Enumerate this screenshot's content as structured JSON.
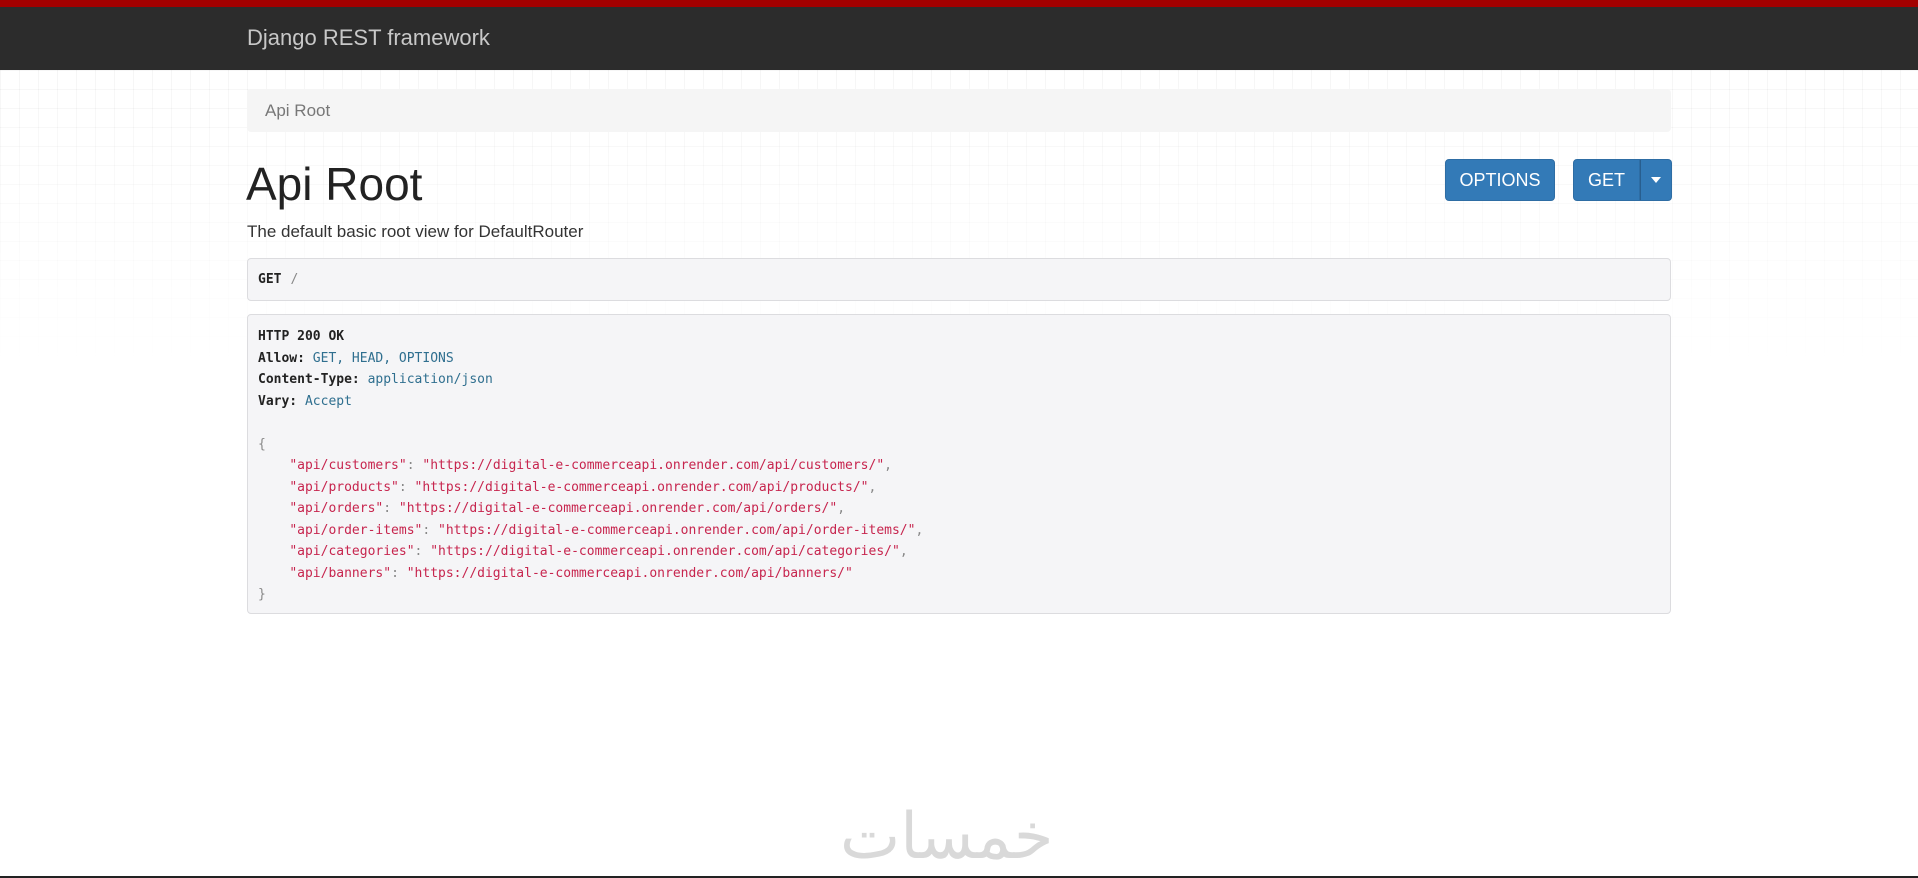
{
  "navbar": {
    "brand": "Django REST framework",
    "accent_color": "#a30000",
    "background_color": "#2c2c2c"
  },
  "breadcrumb": {
    "items": [
      "Api Root"
    ]
  },
  "page": {
    "title": "Api Root",
    "description": "The default basic root view for DefaultRouter"
  },
  "actions": {
    "options_label": "OPTIONS",
    "get_label": "GET",
    "dropdown_icon": "caret-down-icon",
    "button_color": "#337ab7"
  },
  "request": {
    "method": "GET",
    "path": "/"
  },
  "response": {
    "status": "HTTP 200 OK",
    "headers": [
      {
        "name": "Allow:",
        "value": "GET, HEAD, OPTIONS"
      },
      {
        "name": "Content-Type:",
        "value": "application/json"
      },
      {
        "name": "Vary:",
        "value": "Accept"
      }
    ],
    "body_open": "{",
    "body_close": "}",
    "entries": [
      {
        "key": "\"api/customers\"",
        "value": "\"https://digital-e-commerceapi.onrender.com/api/customers/\"",
        "comma": ","
      },
      {
        "key": "\"api/products\"",
        "value": "\"https://digital-e-commerceapi.onrender.com/api/products/\"",
        "comma": ","
      },
      {
        "key": "\"api/orders\"",
        "value": "\"https://digital-e-commerceapi.onrender.com/api/orders/\"",
        "comma": ","
      },
      {
        "key": "\"api/order-items\"",
        "value": "\"https://digital-e-commerceapi.onrender.com/api/order-items/\"",
        "comma": ","
      },
      {
        "key": "\"api/categories\"",
        "value": "\"https://digital-e-commerceapi.onrender.com/api/categories/\"",
        "comma": ","
      },
      {
        "key": "\"api/banners\"",
        "value": "\"https://digital-e-commerceapi.onrender.com/api/banners/\"",
        "comma": ""
      }
    ]
  },
  "watermark": {
    "text": "خمسات"
  }
}
